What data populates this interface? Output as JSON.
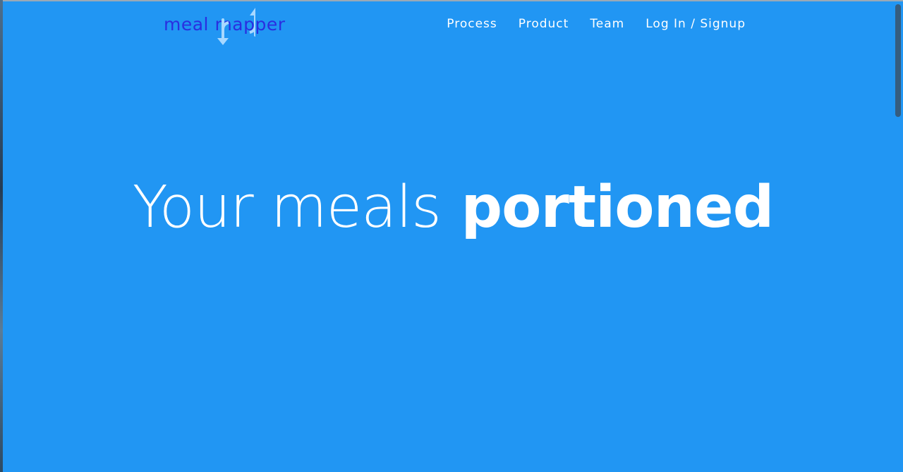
{
  "brand": {
    "name": "meal mapper",
    "logo_icon": "up-down-arrows-icon",
    "logo_text_color": "#2a2fe0",
    "arrow_color": "#a8d8ff"
  },
  "nav": {
    "items": [
      {
        "label": "Process"
      },
      {
        "label": "Product"
      },
      {
        "label": "Team"
      },
      {
        "label": "Log In / Signup"
      }
    ]
  },
  "hero": {
    "title_light": "Your meals",
    "title_bold": "portioned"
  },
  "colors": {
    "background": "#2196f3",
    "text": "#ffffff"
  }
}
